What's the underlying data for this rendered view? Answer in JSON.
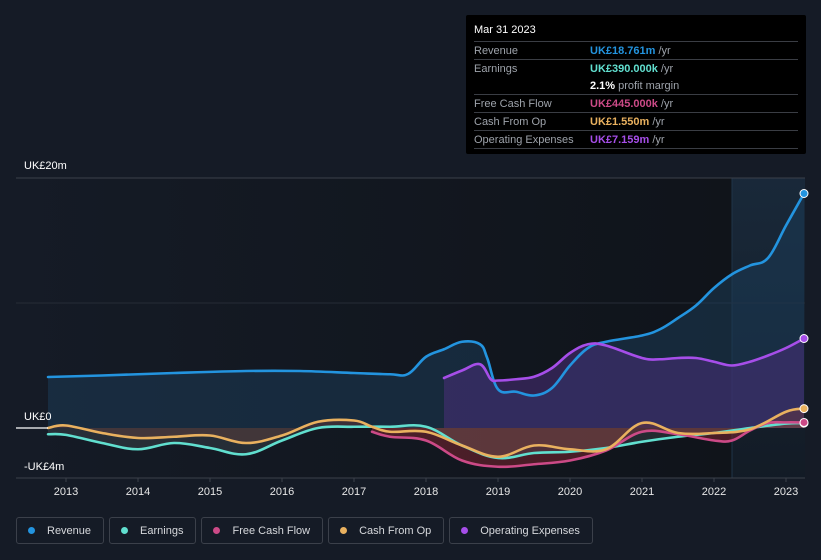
{
  "tooltip": {
    "date": "Mar 31 2023",
    "rows": [
      {
        "label": "Revenue",
        "value": "UK£18.761m",
        "unit": "/yr",
        "color": "#2394df"
      },
      {
        "label": "Earnings",
        "value": "UK£390.000k",
        "unit": "/yr",
        "color": "#61dfcf"
      },
      {
        "label": "",
        "value": "2.1%",
        "unit": "profit margin",
        "color": "#ffffff"
      },
      {
        "label": "Free Cash Flow",
        "value": "UK£445.000k",
        "unit": "/yr",
        "color": "#cc4a87"
      },
      {
        "label": "Cash From Op",
        "value": "UK£1.550m",
        "unit": "/yr",
        "color": "#e9b15f"
      },
      {
        "label": "Operating Expenses",
        "value": "UK£7.159m",
        "unit": "/yr",
        "color": "#a64ee9"
      }
    ]
  },
  "legend": [
    {
      "label": "Revenue",
      "color": "#2394df"
    },
    {
      "label": "Earnings",
      "color": "#61dfcf"
    },
    {
      "label": "Free Cash Flow",
      "color": "#cc4a87"
    },
    {
      "label": "Cash From Op",
      "color": "#e9b15f"
    },
    {
      "label": "Operating Expenses",
      "color": "#a64ee9"
    }
  ],
  "chart_data": {
    "type": "area",
    "title": "",
    "xlabel": "",
    "ylabel": "",
    "y_tick_labels": [
      {
        "value": 20,
        "label": "UK£20m"
      },
      {
        "value": 0,
        "label": "UK£0"
      },
      {
        "value": -4,
        "label": "-UK£4m"
      }
    ],
    "ylim": [
      -4,
      20
    ],
    "xlim": [
      2012.5,
      2023.3
    ],
    "x_ticks": [
      2013,
      2014,
      2015,
      2016,
      2017,
      2018,
      2019,
      2020,
      2021,
      2022,
      2023
    ],
    "x_tick_labels": [
      "2013",
      "2014",
      "2015",
      "2016",
      "2017",
      "2018",
      "2019",
      "2020",
      "2021",
      "2022",
      "2023"
    ],
    "highlight_start": 2022.25,
    "grid": "horizontal",
    "series": [
      {
        "name": "Revenue",
        "color": "#2394df",
        "x": [
          2012.75,
          2013.5,
          2014.5,
          2015.5,
          2016.25,
          2017,
          2017.5,
          2017.75,
          2018,
          2018.25,
          2018.5,
          2018.75,
          2018.85,
          2019,
          2019.25,
          2019.5,
          2019.75,
          2020,
          2020.25,
          2020.5,
          2021,
          2021.25,
          2021.5,
          2021.75,
          2022,
          2022.25,
          2022.5,
          2022.75,
          2023,
          2023.25
        ],
        "values": [
          4.08,
          4.2,
          4.4,
          4.56,
          4.56,
          4.4,
          4.3,
          4.32,
          5.7,
          6.3,
          6.9,
          6.7,
          5.6,
          3.1,
          2.9,
          2.6,
          3.2,
          5.0,
          6.4,
          6.9,
          7.4,
          7.9,
          8.8,
          9.8,
          11.2,
          12.3,
          13.0,
          13.6,
          16.2,
          18.76
        ]
      },
      {
        "name": "Earnings",
        "color": "#61dfcf",
        "x": [
          2012.75,
          2013,
          2013.5,
          2014,
          2014.5,
          2015,
          2015.5,
          2016,
          2016.5,
          2017,
          2017.5,
          2018,
          2018.5,
          2019,
          2019.5,
          2020,
          2020.5,
          2021,
          2021.5,
          2022,
          2022.5,
          2023,
          2023.25
        ],
        "values": [
          -0.5,
          -0.55,
          -1.2,
          -1.7,
          -1.2,
          -1.6,
          -2.1,
          -1.0,
          0.0,
          0.1,
          0.1,
          0.1,
          -1.4,
          -2.4,
          -2.0,
          -1.9,
          -1.6,
          -1.1,
          -0.7,
          -0.4,
          0.0,
          0.35,
          0.39
        ]
      },
      {
        "name": "Free Cash Flow",
        "color": "#cc4a87",
        "x": [
          2017.25,
          2017.5,
          2018,
          2018.5,
          2019,
          2019.5,
          2020,
          2020.5,
          2021,
          2021.5,
          2022,
          2022.25,
          2022.5,
          2022.75,
          2023,
          2023.25
        ],
        "values": [
          -0.3,
          -0.7,
          -1.0,
          -2.6,
          -3.1,
          -2.9,
          -2.6,
          -1.8,
          -0.3,
          -0.5,
          -1.0,
          -1.0,
          -0.2,
          0.4,
          0.45,
          0.445
        ]
      },
      {
        "name": "Cash From Op",
        "color": "#e9b15f",
        "x": [
          2012.75,
          2013,
          2013.5,
          2014,
          2014.5,
          2015,
          2015.5,
          2016,
          2016.5,
          2017,
          2017.25,
          2017.5,
          2018,
          2018.5,
          2019,
          2019.5,
          2020,
          2020.5,
          2021,
          2021.5,
          2022,
          2022.5,
          2023,
          2023.25
        ],
        "values": [
          0.0,
          0.2,
          -0.4,
          -0.8,
          -0.7,
          -0.6,
          -1.2,
          -0.6,
          0.5,
          0.6,
          0.1,
          -0.3,
          -0.3,
          -1.4,
          -2.3,
          -1.4,
          -1.7,
          -1.7,
          0.4,
          -0.4,
          -0.4,
          -0.1,
          1.3,
          1.55
        ]
      },
      {
        "name": "Operating Expenses",
        "color": "#a64ee9",
        "x": [
          2018.25,
          2018.5,
          2018.75,
          2018.9,
          2019,
          2019.25,
          2019.5,
          2019.75,
          2020,
          2020.25,
          2020.5,
          2021,
          2021.25,
          2021.5,
          2021.75,
          2022,
          2022.25,
          2022.5,
          2022.75,
          2023,
          2023.25
        ],
        "values": [
          4.0,
          4.6,
          5.1,
          3.9,
          3.8,
          3.9,
          4.1,
          4.8,
          6.0,
          6.7,
          6.6,
          5.6,
          5.5,
          5.6,
          5.6,
          5.3,
          5.0,
          5.3,
          5.8,
          6.4,
          7.16
        ]
      }
    ]
  }
}
